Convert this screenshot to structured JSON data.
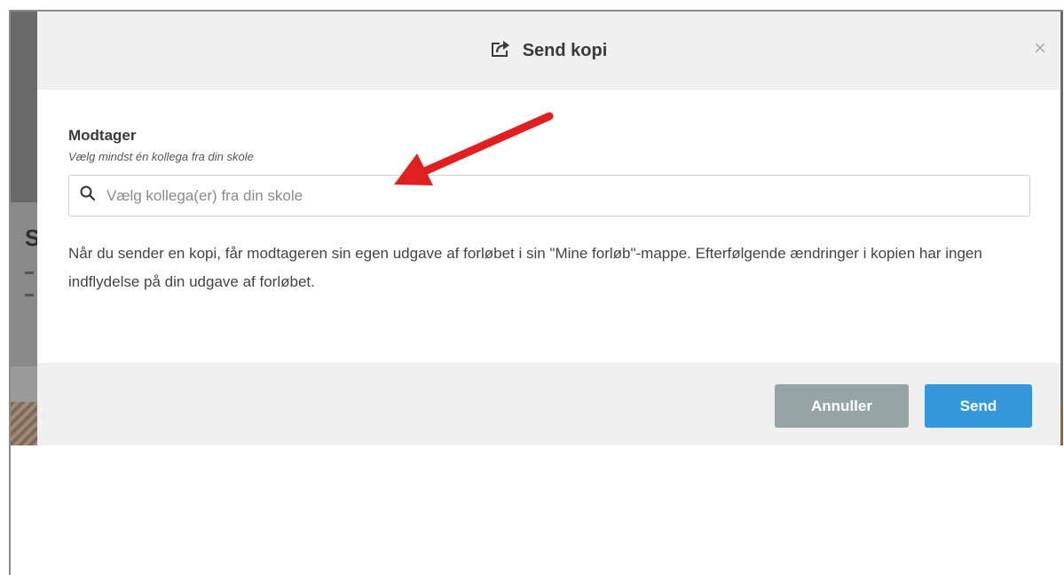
{
  "dialog": {
    "title": "Send kopi",
    "close_label": "×"
  },
  "recipient": {
    "label": "Modtager",
    "hint": "Vælg mindst én kollega fra din skole",
    "search_placeholder": "Vælg kollega(er) fra din skole",
    "search_value": ""
  },
  "info": {
    "text": "Når du sender en kopi, får modtageren sin egen udgave af forløbet i sin \"Mine forløb\"-mappe. Efterfølgende ændringer i kopien har ingen indflydelse på din udgave af forløbet."
  },
  "footer": {
    "cancel_label": "Annuller",
    "send_label": "Send"
  },
  "background": {
    "partial_heading_letter": "S"
  },
  "colors": {
    "header_bg": "#f0f0f0",
    "cancel_button": "#95a5a6",
    "send_button": "#3498db",
    "annotation_arrow": "#e02020"
  },
  "icons": {
    "title_icon": "share-icon",
    "search_icon": "search-icon",
    "close_icon": "close-icon",
    "annotation": "red-arrow-icon"
  }
}
